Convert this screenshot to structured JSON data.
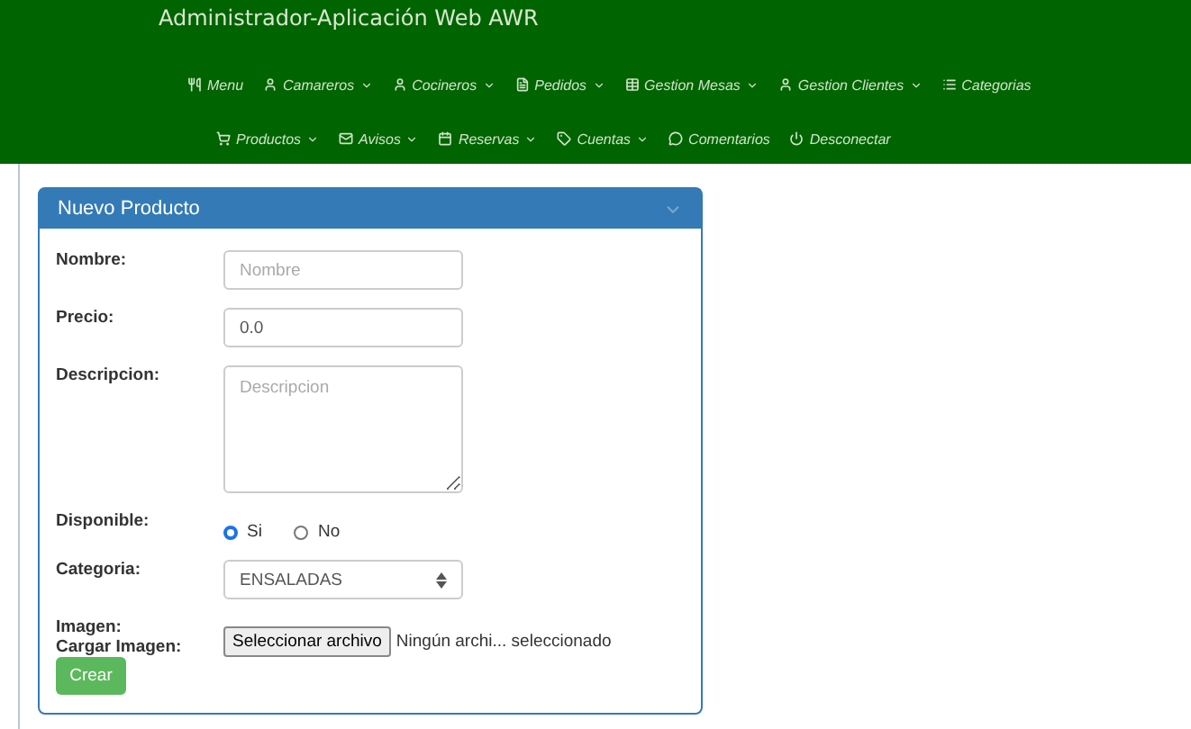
{
  "header": {
    "title": "Administrador-Aplicación Web AWR"
  },
  "nav_rows": [
    [
      {
        "kind": "utensils",
        "label": "Menu",
        "dropdown": false
      },
      {
        "kind": "user",
        "label": "Camareros",
        "dropdown": true
      },
      {
        "kind": "user",
        "label": "Cocineros",
        "dropdown": true
      },
      {
        "kind": "file",
        "label": "Pedidos",
        "dropdown": true
      },
      {
        "kind": "table",
        "label": "Gestion Mesas",
        "dropdown": true
      },
      {
        "kind": "user",
        "label": "Gestion Clientes",
        "dropdown": true
      },
      {
        "kind": "list",
        "label": "Categorias",
        "dropdown": false
      }
    ],
    [
      {
        "kind": "cart",
        "label": "Productos",
        "dropdown": true
      },
      {
        "kind": "mail",
        "label": "Avisos",
        "dropdown": true
      },
      {
        "kind": "calendar",
        "label": "Reservas",
        "dropdown": true
      },
      {
        "kind": "tag",
        "label": "Cuentas",
        "dropdown": true
      },
      {
        "kind": "chat",
        "label": "Comentarios",
        "dropdown": false
      },
      {
        "kind": "power",
        "label": "Desconectar",
        "dropdown": false
      }
    ]
  ],
  "panel": {
    "title": "Nuevo Producto",
    "expanded": true
  },
  "form": {
    "nombre": {
      "label": "Nombre:",
      "placeholder": "Nombre"
    },
    "precio": {
      "label": "Precio:",
      "value": "0.0"
    },
    "descripcion": {
      "label": "Descripcion:",
      "placeholder": "Descripcion"
    },
    "disponible": {
      "label": "Disponible:",
      "options": [
        {
          "label": "Si",
          "selected": true
        },
        {
          "label": "No",
          "selected": false
        }
      ]
    },
    "categoria": {
      "label": "Categoria:",
      "value": "ENSALADAS"
    },
    "imagen": {
      "label": "Imagen:"
    },
    "cargar": {
      "label": "Cargar Imagen:",
      "button": "Seleccionar archivo",
      "status": "Ningún archi... seleccionado"
    },
    "submit": "Crear"
  }
}
